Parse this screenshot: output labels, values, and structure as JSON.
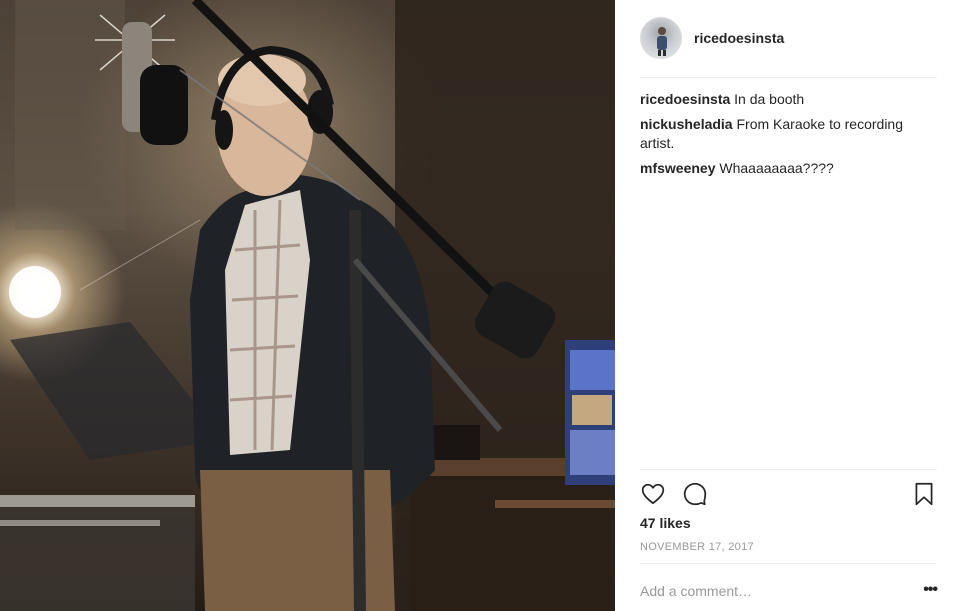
{
  "post": {
    "image_alt": "Man in recording booth standing at a microphone",
    "author": {
      "username": "ricedoesinsta"
    },
    "comments": [
      {
        "user": "ricedoesinsta",
        "text": "In da booth"
      },
      {
        "user": "nickusheladia",
        "text": "From Karaoke to recording artist."
      },
      {
        "user": "mfsweeney",
        "text": "Whaaaaaaaa????"
      }
    ],
    "likes_text": "47 likes",
    "date_text": "NOVEMBER 17, 2017",
    "add_comment_placeholder": "Add a comment…",
    "more_label": "•••"
  },
  "icons": {
    "like": "heart-icon",
    "comment": "comment-icon",
    "save": "bookmark-icon",
    "more": "more-options-icon"
  },
  "colors": {
    "text": "#262626",
    "secondary": "#999999",
    "divider": "#efefef"
  }
}
